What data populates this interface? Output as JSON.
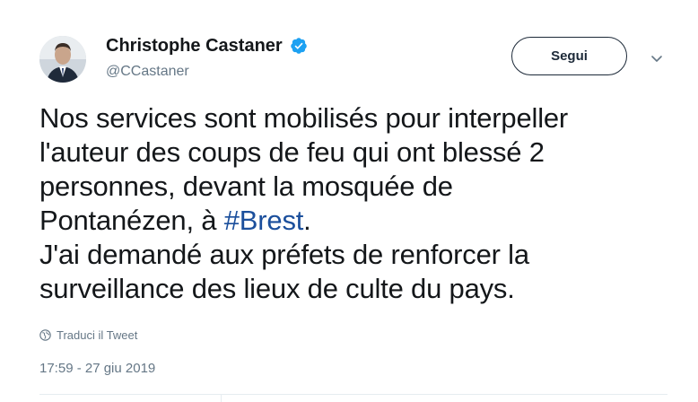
{
  "author": {
    "display_name": "Christophe Castaner",
    "handle": "@CCastaner",
    "verified": true
  },
  "actions": {
    "follow_label": "Segui"
  },
  "tweet": {
    "lines": [
      "Nos services sont mobilisés pour interpeller",
      "l'auteur des coups de feu qui ont blessé 2",
      "personnes, devant la mosquée de",
      "Pontanézen, à ",
      "J'ai demandé aux préfets de renforcer la",
      "surveillance des lieux de culte du pays."
    ],
    "hashtag": "#Brest",
    "after_hashtag": "."
  },
  "translate_label": "Traduci il Tweet",
  "timestamp": "17:59 - 27 giu 2019",
  "colors": {
    "text": "#14171a",
    "secondary": "#657786",
    "hashtag": "#1b4f9c",
    "verified": "#1da1f2",
    "divider": "#e6ecf0"
  },
  "icons": {
    "verified": "verified-badge-icon",
    "caret": "chevron-down-icon",
    "translate": "globe-icon"
  }
}
